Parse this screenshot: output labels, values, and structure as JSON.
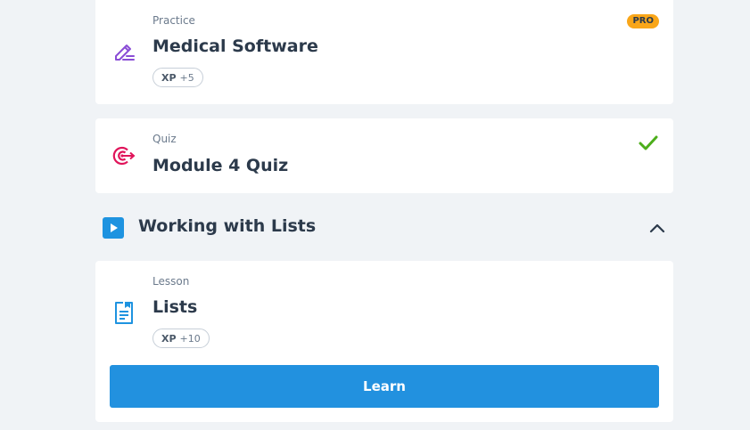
{
  "practice_card": {
    "type_label": "Practice",
    "title": "Medical Software",
    "xp_label": "XP",
    "xp_value": "+5",
    "pro_badge": "PRO",
    "icon": "pencil-icon"
  },
  "quiz_card": {
    "type_label": "Quiz",
    "title": "Module 4 Quiz",
    "icon": "target-icon",
    "status_icon": "checkmark-icon",
    "completed": true
  },
  "section": {
    "title": "Working with Lists",
    "icon": "play-icon",
    "toggle_icon": "chevron-up-icon",
    "expanded": true
  },
  "lesson_card": {
    "type_label": "Lesson",
    "title": "Lists",
    "xp_label": "XP",
    "xp_value": "+10",
    "icon": "document-icon",
    "button_label": "Learn"
  },
  "colors": {
    "background": "#f0f3f6",
    "primary": "#2291df",
    "pro": "#f9a619",
    "success": "#4cae1b",
    "practice_icon": "#8a4dd6",
    "quiz_icon": "#e0145a"
  }
}
